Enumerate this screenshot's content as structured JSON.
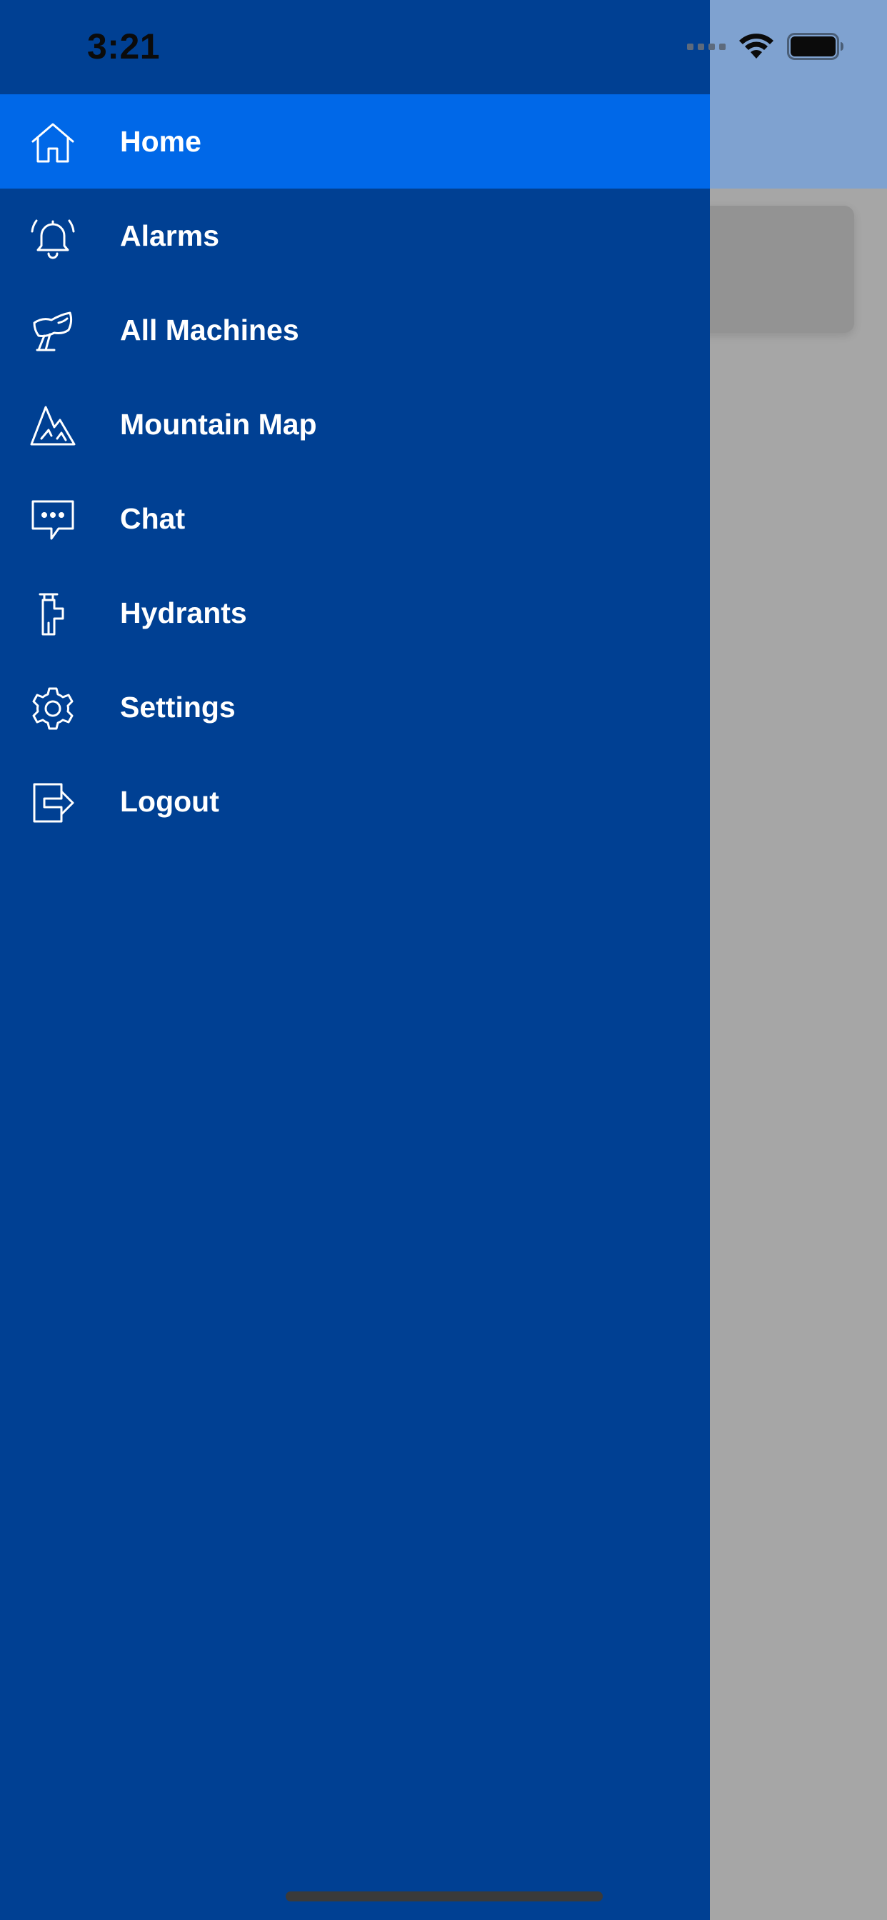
{
  "status_bar": {
    "time": "3:21"
  },
  "menu": {
    "items": [
      {
        "label": "Home",
        "icon": "home-icon",
        "active": true
      },
      {
        "label": "Alarms",
        "icon": "bell-icon",
        "active": false
      },
      {
        "label": "All Machines",
        "icon": "snow-machine-icon",
        "active": false
      },
      {
        "label": "Mountain Map",
        "icon": "mountain-icon",
        "active": false
      },
      {
        "label": "Chat",
        "icon": "chat-bubble-icon",
        "active": false
      },
      {
        "label": "Hydrants",
        "icon": "hydrant-icon",
        "active": false
      },
      {
        "label": "Settings",
        "icon": "gear-icon",
        "active": false
      },
      {
        "label": "Logout",
        "icon": "logout-icon",
        "active": false
      }
    ]
  },
  "colors": {
    "drawer_bg": "#004093",
    "active_item_bg": "#0068e8",
    "overlay_gray": "#a6a6a6",
    "header_dimmed": "#7fa2d0",
    "label_text": "#ffffff"
  }
}
